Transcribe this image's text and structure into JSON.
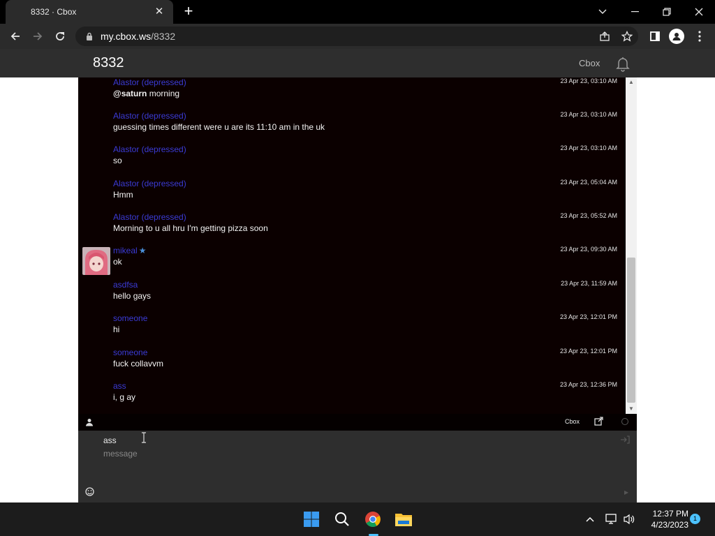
{
  "browser": {
    "tab_title": "8332 · Cbox",
    "url_host": "my.cbox.ws",
    "url_path": "/8332"
  },
  "site": {
    "title": "8332",
    "brand": "Cbox"
  },
  "messages": [
    {
      "name": "Alastor (depressed)",
      "time": "23 Apr 23, 03:10 AM",
      "mention": "@saturn",
      "text": " morning"
    },
    {
      "name": "Alastor (depressed)",
      "time": "23 Apr 23, 03:10 AM",
      "mention": "",
      "text": "guessing times different were u are its 11:10 am in the uk"
    },
    {
      "name": "Alastor (depressed)",
      "time": "23 Apr 23, 03:10 AM",
      "mention": "",
      "text": "so"
    },
    {
      "name": "Alastor (depressed)",
      "time": "23 Apr 23, 05:04 AM",
      "mention": "",
      "text": "Hmm"
    },
    {
      "name": "Alastor (depressed)",
      "time": "23 Apr 23, 05:52 AM",
      "mention": "",
      "text": "Morning to u all hru I'm getting pizza soon"
    },
    {
      "name": "mikeal",
      "time": "23 Apr 23, 09:30 AM",
      "mention": "",
      "text": "ok",
      "avatar": true,
      "star": true
    },
    {
      "name": "asdfsa",
      "time": "23 Apr 23, 11:59 AM",
      "mention": "",
      "text": "hello gays"
    },
    {
      "name": "someone",
      "time": "23 Apr 23, 12:01 PM",
      "mention": "",
      "text": "hi"
    },
    {
      "name": "someone",
      "time": "23 Apr 23, 12:01 PM",
      "mention": "",
      "text": "fuck collavvm"
    },
    {
      "name": "ass",
      "time": "23 Apr 23, 12:36 PM",
      "mention": "",
      "text": "i, g ay"
    }
  ],
  "chatbar": {
    "cbox_label": "Cbox"
  },
  "compose": {
    "name_value": "ass",
    "message_placeholder": "message"
  },
  "taskbar": {
    "time": "12:37 PM",
    "date": "4/23/2023",
    "notifications": "1"
  },
  "colors": {
    "username": "#3b3bd6",
    "chat_bg": "#0b0000",
    "accent": "#4cc2ff"
  }
}
